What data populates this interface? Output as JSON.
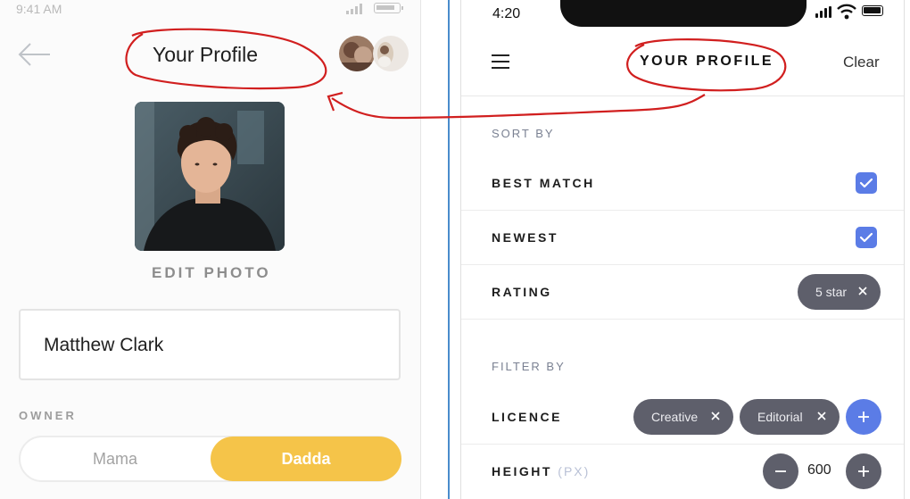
{
  "left_screen": {
    "status_time": "9:41 AM",
    "back_icon": "arrow-left-icon",
    "title": "Your Profile",
    "edit_photo_label": "EDIT PHOTO",
    "name_value": "Matthew Clark",
    "owner_label": "OWNER",
    "owner_options": [
      "Mama",
      "Dadda"
    ],
    "owner_selected": "Dadda",
    "accent_color": "#f5c449"
  },
  "right_screen": {
    "status_time": "4:20",
    "menu_icon": "hamburger-icon",
    "title": "YOUR PROFILE",
    "clear_label": "Clear",
    "sort_by_label": "SORT BY",
    "sort_rows": [
      {
        "label": "BEST MATCH",
        "checked": true
      },
      {
        "label": "NEWEST",
        "checked": true
      }
    ],
    "rating_label": "RATING",
    "rating_chip": "5 star",
    "filter_by_label": "FILTER BY",
    "licence_label": "LICENCE",
    "licence_chips": [
      "Creative",
      "Editorial"
    ],
    "height_label": "HEIGHT",
    "height_unit": "(PX)",
    "height_value": "600",
    "accent_color": "#5b7ce6",
    "chip_color": "#5e5f6b"
  },
  "annotation_color": "#d11f1f"
}
